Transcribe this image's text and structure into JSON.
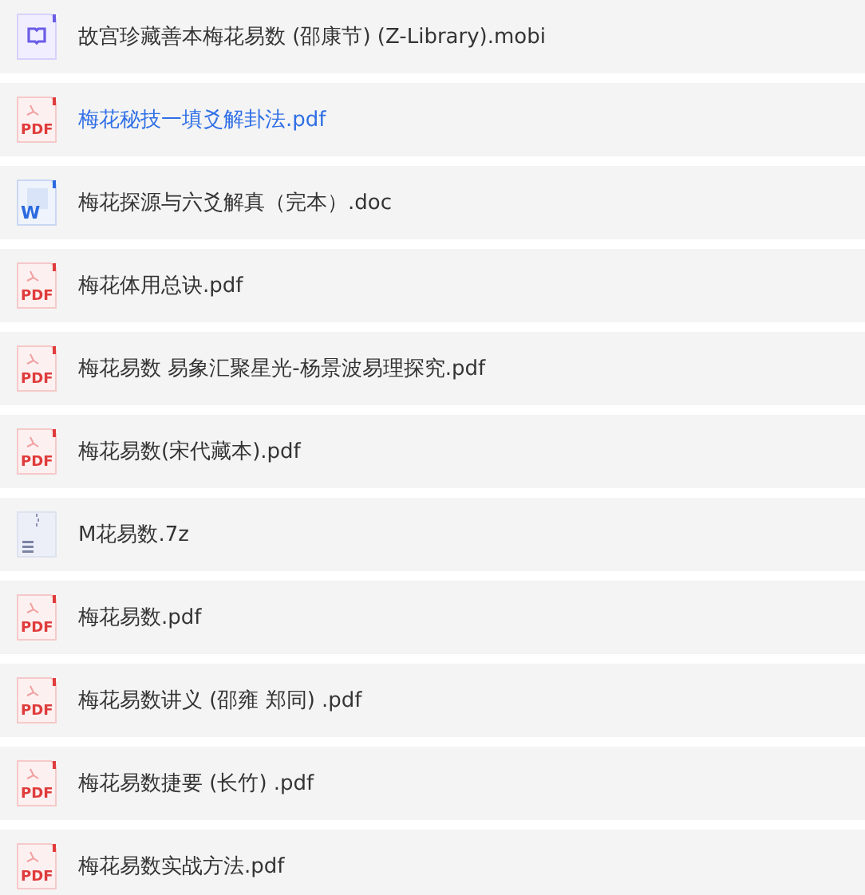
{
  "files": [
    {
      "kind": "mobi",
      "name": "故宫珍藏善本梅花易数 (邵康节) (Z-Library).mobi",
      "selected": false
    },
    {
      "kind": "pdf",
      "icon_text": "PDF",
      "name": "梅花秘技一填爻解卦法.pdf",
      "selected": true
    },
    {
      "kind": "doc",
      "icon_text": "W",
      "name": "梅花探源与六爻解真（完本）.doc",
      "selected": false
    },
    {
      "kind": "pdf",
      "icon_text": "PDF",
      "name": "梅花体用总诀.pdf",
      "selected": false
    },
    {
      "kind": "pdf",
      "icon_text": "PDF",
      "name": "梅花易数 易象汇聚星光-杨景波易理探究.pdf",
      "selected": false
    },
    {
      "kind": "pdf",
      "icon_text": "PDF",
      "name": "梅花易数(宋代藏本).pdf",
      "selected": false
    },
    {
      "kind": "archive",
      "name": "M花易数.7z",
      "selected": false
    },
    {
      "kind": "pdf",
      "icon_text": "PDF",
      "name": "梅花易数.pdf",
      "selected": false
    },
    {
      "kind": "pdf",
      "icon_text": "PDF",
      "name": "梅花易数讲义 (邵雍 郑同) .pdf",
      "selected": false
    },
    {
      "kind": "pdf",
      "icon_text": "PDF",
      "name": "梅花易数捷要 (长竹) .pdf",
      "selected": false
    },
    {
      "kind": "pdf",
      "icon_text": "PDF",
      "name": "梅花易数实战方法.pdf",
      "selected": false
    }
  ]
}
